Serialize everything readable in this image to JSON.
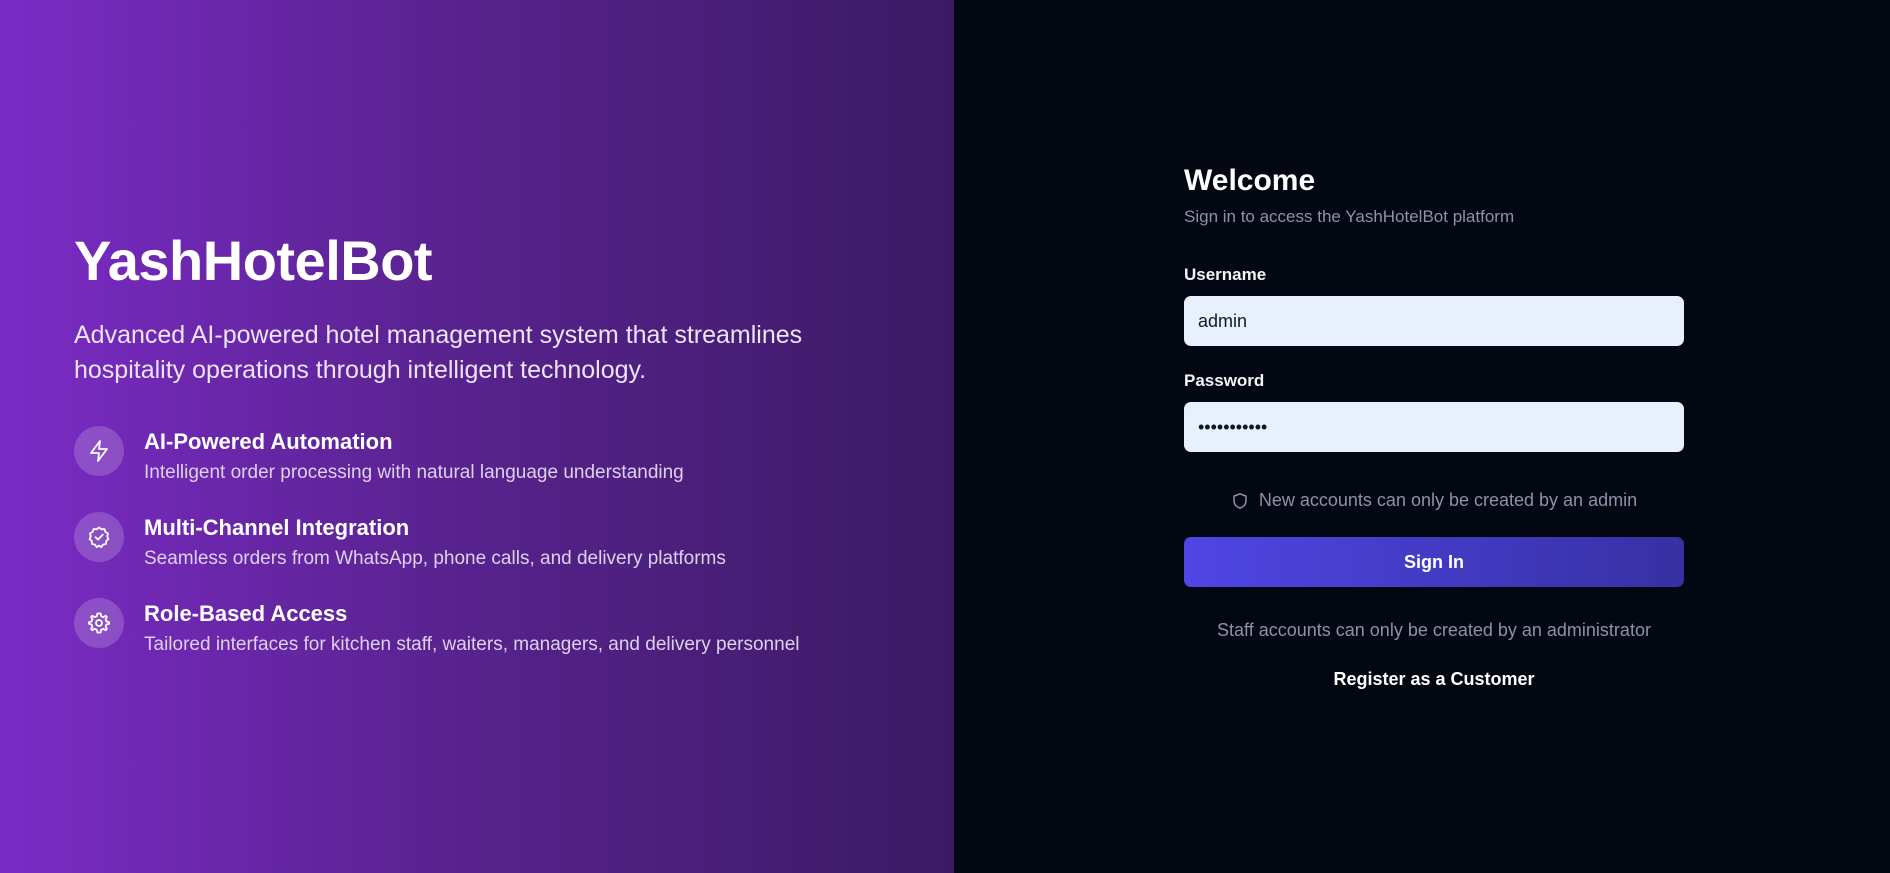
{
  "hero": {
    "brand": "YashHotelBot",
    "tagline": "Advanced AI-powered hotel management system that streamlines hospitality operations through intelligent technology.",
    "features": [
      {
        "icon": "lightning-icon",
        "title": "AI-Powered Automation",
        "description": "Intelligent order processing with natural language understanding"
      },
      {
        "icon": "check-circle-icon",
        "title": "Multi-Channel Integration",
        "description": "Seamless orders from WhatsApp, phone calls, and delivery platforms"
      },
      {
        "icon": "gear-icon",
        "title": "Role-Based Access",
        "description": "Tailored interfaces for kitchen staff, waiters, managers, and delivery personnel"
      }
    ]
  },
  "login": {
    "title": "Welcome",
    "subtitle": "Sign in to access the YashHotelBot platform",
    "username_label": "Username",
    "username_value": "admin",
    "password_label": "Password",
    "password_value": "•••••••••••",
    "notice": "New accounts can only be created by an admin",
    "notice_icon": "shield-icon",
    "signin_label": "Sign In",
    "staff_note": "Staff accounts can only be created by an administrator",
    "register_label": "Register as a Customer"
  },
  "colors": {
    "hero_gradient_start": "#7b2bc6",
    "hero_gradient_end": "#3b1a63",
    "login_background": "#030712",
    "input_background": "#e8f0fe",
    "button_gradient_start": "#4f46e5",
    "button_gradient_end": "#3730a3"
  }
}
